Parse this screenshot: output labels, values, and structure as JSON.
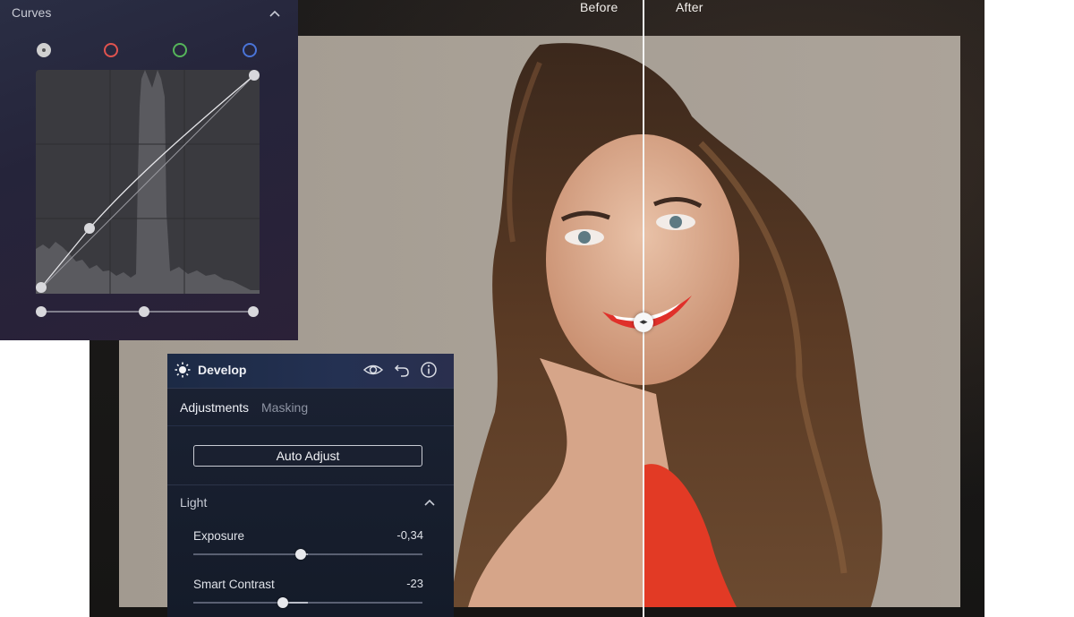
{
  "compare": {
    "before_label": "Before",
    "after_label": "After"
  },
  "curves": {
    "title": "Curves",
    "channels": [
      {
        "name": "luminance",
        "color": "#d0d0d0"
      },
      {
        "name": "red",
        "color": "#e0534f"
      },
      {
        "name": "green",
        "color": "#55b55a"
      },
      {
        "name": "blue",
        "color": "#4a74d8"
      }
    ]
  },
  "develop": {
    "title": "Develop",
    "tabs": [
      {
        "label": "Adjustments",
        "active": true
      },
      {
        "label": "Masking",
        "active": false
      }
    ],
    "auto_adjust_label": "Auto Adjust",
    "section_light": "Light",
    "sliders": [
      {
        "label": "Exposure",
        "value": "-0,34",
        "position": 0.47
      },
      {
        "label": "Smart Contrast",
        "value": "-23",
        "position": 0.39
      }
    ]
  },
  "colors": {
    "accent_lipstick": "#e0302a",
    "panel_bg": "#1b2233"
  }
}
